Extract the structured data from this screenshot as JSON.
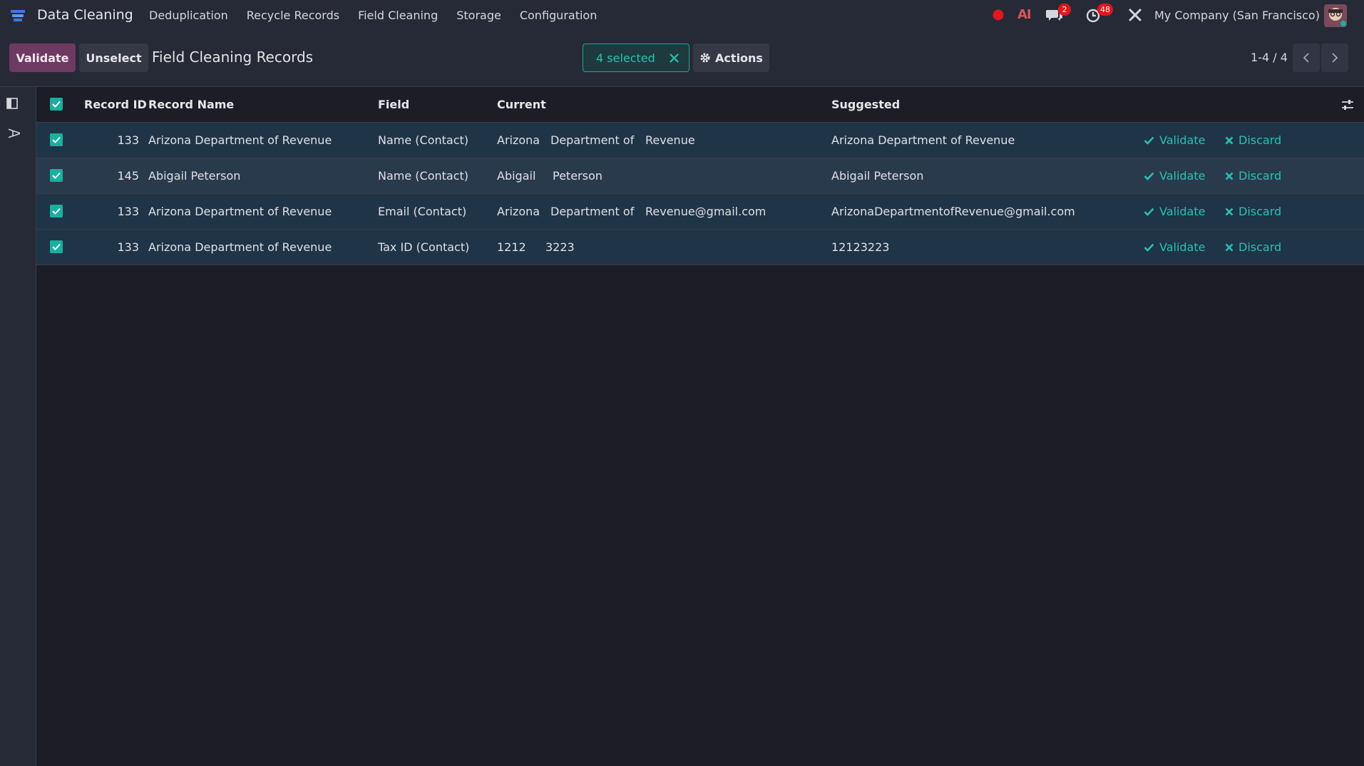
{
  "navbar": {
    "app_name": "Data Cleaning",
    "menu": [
      "Deduplication",
      "Recycle Records",
      "Field Cleaning",
      "Storage",
      "Configuration"
    ],
    "ai_label": "AI",
    "messages_count": "2",
    "activities_count": "48",
    "company": "My Company (San Francisco)"
  },
  "control": {
    "validate_label": "Validate",
    "unselect_label": "Unselect",
    "title": "Field Cleaning Records",
    "selected_label": "4 selected",
    "actions_label": "Actions",
    "pager": "1-4 / 4"
  },
  "table": {
    "headers": {
      "record_id": "Record ID",
      "record_name": "Record Name",
      "field": "Field",
      "current": "Current",
      "suggested": "Suggested"
    },
    "action_validate": "Validate",
    "action_discard": "Discard",
    "rows": [
      {
        "id": "133",
        "name": "Arizona Department of Revenue",
        "field": "Name (Contact)",
        "current": [
          "Arizona",
          "Department of",
          "Revenue"
        ],
        "suggested": "Arizona Department of Revenue"
      },
      {
        "id": "145",
        "name": "Abigail Peterson",
        "field": "Name (Contact)",
        "current": [
          "Abigail",
          "Peterson",
          ""
        ],
        "suggested": "Abigail Peterson"
      },
      {
        "id": "133",
        "name": "Arizona Department of Revenue",
        "field": "Email (Contact)",
        "current": [
          "Arizona",
          "Department of",
          "Revenue@gmail.com"
        ],
        "suggested": "ArizonaDepartmentofRevenue@gmail.com"
      },
      {
        "id": "133",
        "name": "Arizona Department of Revenue",
        "field": "Tax ID (Contact)",
        "current": [
          "1212",
          "3223",
          ""
        ],
        "suggested": "12123223"
      }
    ]
  },
  "colors": {
    "accent": "#27c2b2",
    "primary": "#6f3a62",
    "badge": "#e5141d"
  }
}
